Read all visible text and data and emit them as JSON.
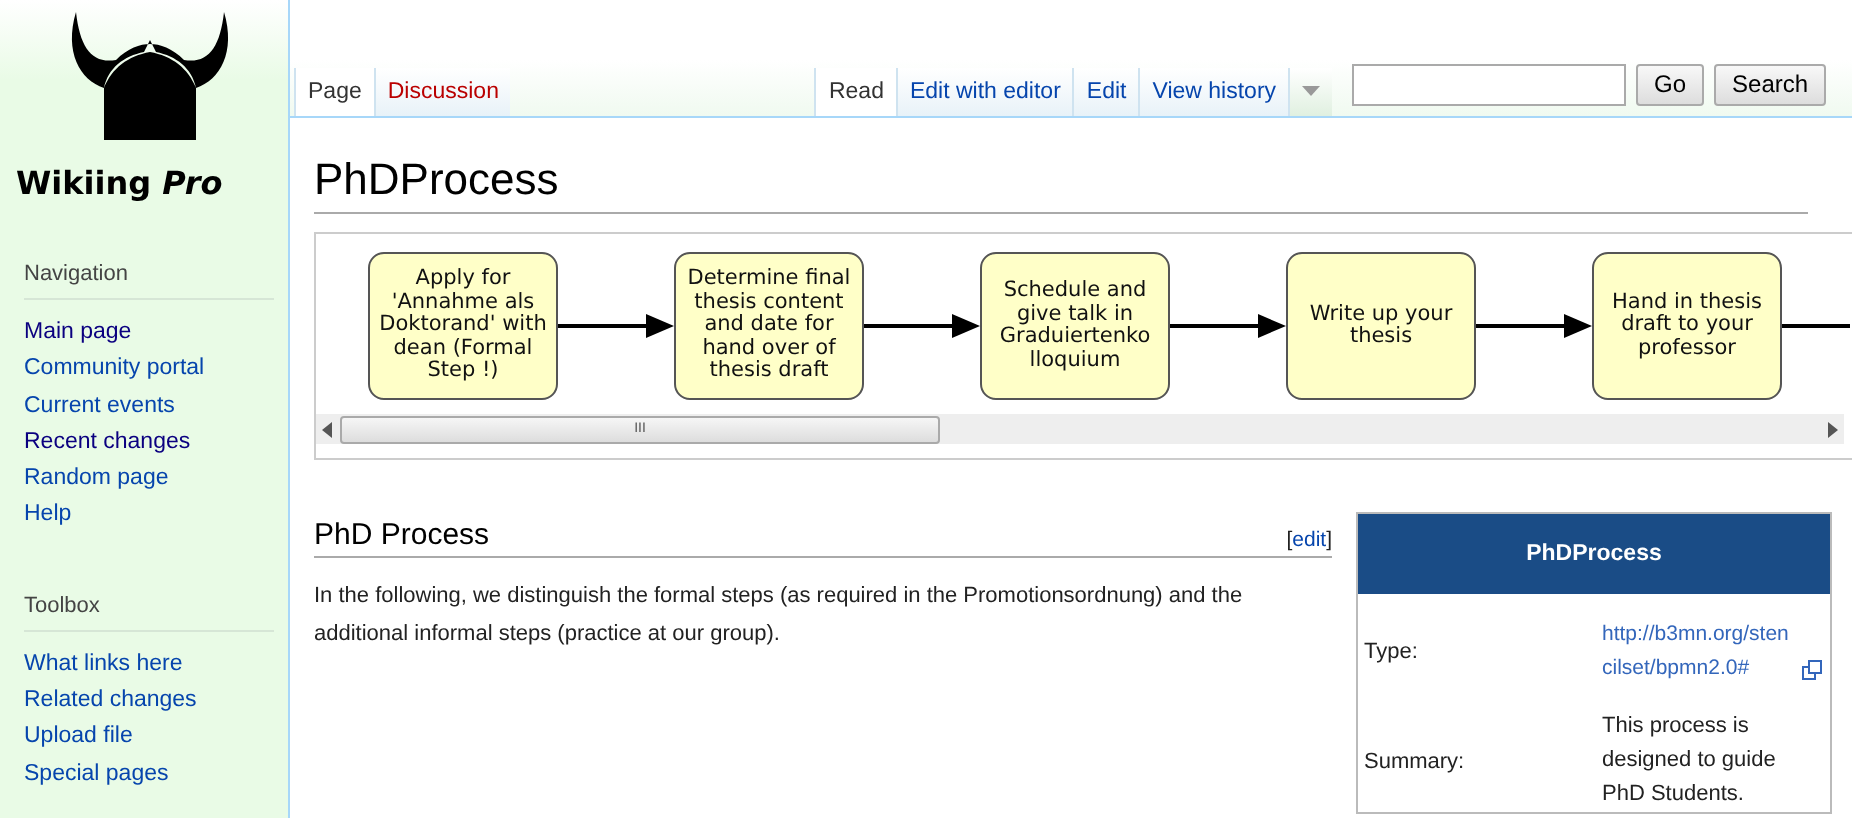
{
  "logo": {
    "text": "Wikiing *Pro*"
  },
  "sidebar": [
    {
      "heading": "Navigation",
      "items": [
        {
          "label": "Main page",
          "visited": true
        },
        {
          "label": "Community portal",
          "visited": false
        },
        {
          "label": "Current events",
          "visited": false
        },
        {
          "label": "Recent changes",
          "visited": true
        },
        {
          "label": "Random page",
          "visited": false
        },
        {
          "label": "Help",
          "visited": false
        }
      ]
    },
    {
      "heading": "Toolbox",
      "items": [
        {
          "label": "What links here",
          "visited": false
        },
        {
          "label": "Related changes",
          "visited": false
        },
        {
          "label": "Upload file",
          "visited": false
        },
        {
          "label": "Special pages",
          "visited": false
        }
      ]
    }
  ],
  "namespace_tabs": [
    {
      "label": "Page",
      "selected": true,
      "missing": false
    },
    {
      "label": "Discussion",
      "selected": false,
      "missing": true
    }
  ],
  "view_tabs": [
    {
      "label": "Read",
      "selected": true
    },
    {
      "label": "Edit with editor",
      "selected": false
    },
    {
      "label": "Edit",
      "selected": false
    },
    {
      "label": "View history",
      "selected": false
    }
  ],
  "search": {
    "go": "Go",
    "search": "Search"
  },
  "title": "PhDProcess",
  "diagram": {
    "steps": [
      "Apply for 'Annahme als Doktorand' with dean (Formal Step !)",
      "Determine final thesis content and date for hand over of thesis draft",
      "Schedule and give talk in Graduiertenko lloquium",
      "Write up your thesis",
      "Hand in thesis draft to your professor"
    ],
    "scroll_thumb_label": "III"
  },
  "section": {
    "heading": "PhD Process",
    "edit_open": "[",
    "edit": "edit",
    "edit_close": "]",
    "paragraph": "In the following, we distinguish the formal steps (as required in the Promotionsordnung) and the additional informal steps (practice at our group)."
  },
  "infobox": {
    "title": "PhDProcess",
    "rows": [
      {
        "label": "Type:",
        "value": "http://b3mn.org/stencilset/bpmn2.0#",
        "kind": "link"
      },
      {
        "label": "Summary:",
        "value": "This process is designed to guide PhD Students.",
        "kind": "text"
      }
    ]
  }
}
